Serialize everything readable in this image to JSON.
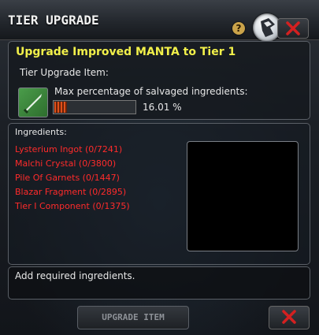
{
  "window": {
    "title": "TIER UPGRADE"
  },
  "icons": {
    "help": "question-mark-icon",
    "logo": "faction-logo-icon",
    "close": "close-x-icon",
    "item": "sword-icon",
    "cancel": "cancel-x-icon"
  },
  "header": {
    "title": "Upgrade Improved MANTA to Tier 1",
    "tier_item_label": "Tier Upgrade Item:",
    "salvage_label": "Max percentage of salvaged ingredients:",
    "salvage_percent": 16.01,
    "salvage_value_text": "16.01 %"
  },
  "ingredients": {
    "title": "Ingredients:",
    "items": [
      "Lysterium Ingot (0/7241)",
      "Malchi Crystal (0/3800)",
      "Pile Of Garnets (0/1447)",
      "Blazar Fragment (0/2895)",
      "Tier I Component (0/1375)"
    ]
  },
  "status": {
    "message": "Add required ingredients."
  },
  "footer": {
    "upgrade_label": "UPGRADE ITEM"
  },
  "colors": {
    "title_yellow": "#f2f04a",
    "ingredient_red": "#ff2b2b",
    "progress_orange": "#e0501a",
    "close_red": "#d42020"
  }
}
